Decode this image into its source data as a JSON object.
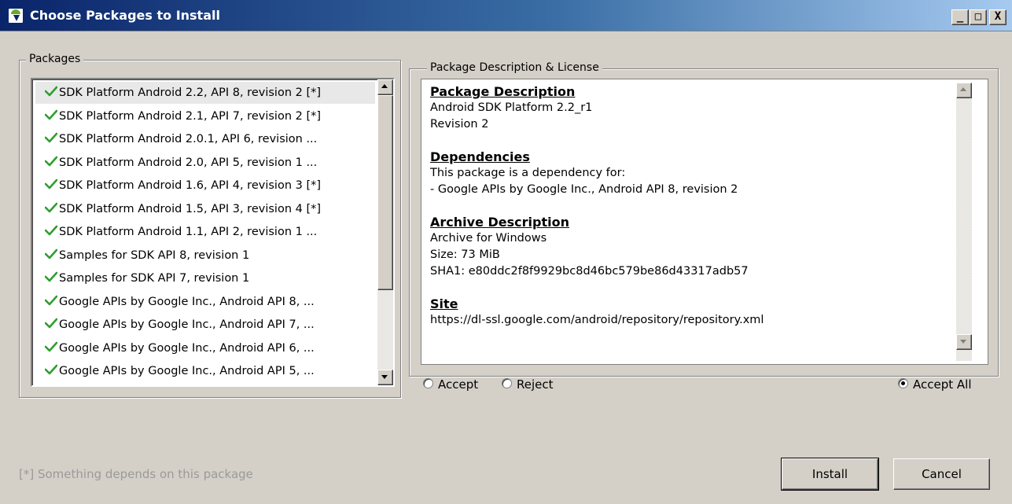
{
  "window": {
    "title": "Choose Packages to Install",
    "controls": {
      "minimize": "_",
      "maximize": "□",
      "close": "X"
    }
  },
  "packages": {
    "legend": "Packages",
    "selected_index": 0,
    "items": [
      {
        "label": "SDK Platform Android 2.2, API 8, revision 2 [*]",
        "status": "accepted"
      },
      {
        "label": "SDK Platform Android 2.1, API 7, revision 2 [*]",
        "status": "accepted"
      },
      {
        "label": "SDK Platform Android 2.0.1, API 6, revision ...",
        "status": "accepted"
      },
      {
        "label": "SDK Platform Android 2.0, API 5, revision 1 ...",
        "status": "accepted"
      },
      {
        "label": "SDK Platform Android 1.6, API 4, revision 3 [*]",
        "status": "accepted"
      },
      {
        "label": "SDK Platform Android 1.5, API 3, revision 4 [*]",
        "status": "accepted"
      },
      {
        "label": "SDK Platform Android 1.1, API 2, revision 1 ...",
        "status": "accepted"
      },
      {
        "label": "Samples for SDK API 8, revision 1",
        "status": "accepted"
      },
      {
        "label": "Samples for SDK API 7, revision 1",
        "status": "accepted"
      },
      {
        "label": "Google APIs by Google Inc., Android API 8, ...",
        "status": "accepted"
      },
      {
        "label": "Google APIs by Google Inc., Android API 7, ...",
        "status": "accepted"
      },
      {
        "label": "Google APIs by Google Inc., Android API 6, ...",
        "status": "accepted"
      },
      {
        "label": "Google APIs by Google Inc., Android API 5, ...",
        "status": "accepted"
      }
    ],
    "check_icon": "green-checkmark-icon",
    "check_color": "#2e9e2e"
  },
  "description": {
    "legend": "Package Description & License",
    "sections": {
      "package": {
        "heading": "Package Description",
        "lines": [
          "Android SDK Platform 2.2_r1",
          "Revision 2"
        ]
      },
      "dependencies": {
        "heading": "Dependencies",
        "lines": [
          "This package is a dependency for:",
          "- Google APIs by Google Inc., Android API 8, revision 2"
        ]
      },
      "archive": {
        "heading": "Archive Description",
        "lines": [
          "Archive for Windows",
          "Size: 73 MiB",
          "SHA1: e80ddc2f8f9929bc8d46bc579be86d43317adb57"
        ]
      },
      "site": {
        "heading": "Site",
        "lines": [
          "https://dl-ssl.google.com/android/repository/repository.xml"
        ]
      }
    }
  },
  "license": {
    "accept": {
      "label": "Accept",
      "checked": false
    },
    "reject": {
      "label": "Reject",
      "checked": false
    },
    "accept_all": {
      "label": "Accept All",
      "checked": true
    }
  },
  "footer": {
    "note": "[*] Something depends on this package",
    "install_label": "Install",
    "cancel_label": "Cancel"
  }
}
